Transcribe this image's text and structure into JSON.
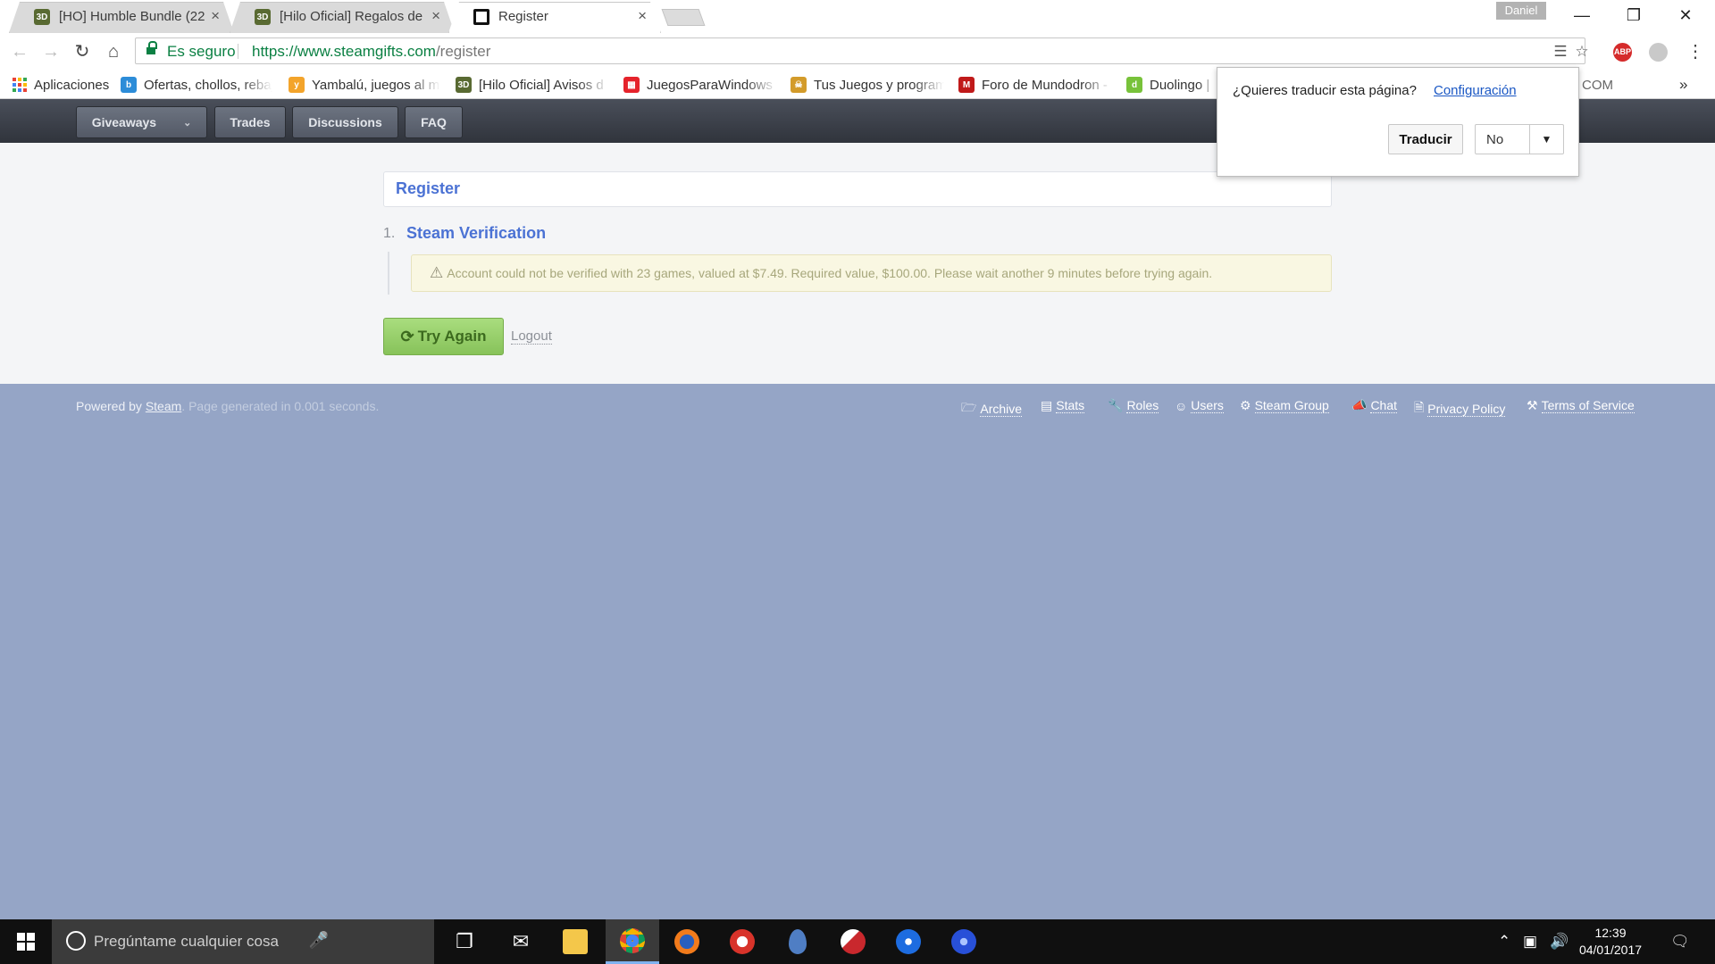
{
  "browser": {
    "tabs": [
      {
        "title": "[HO] Humble Bundle (22",
        "icon": "3djuegos-icon"
      },
      {
        "title": "[Hilo Oficial] Regalos de",
        "icon": "3djuegos-icon"
      },
      {
        "title": "Register",
        "icon": "steamgifts-icon"
      }
    ],
    "profile_name": "Daniel",
    "secure_label": "Es seguro",
    "url_host": "https://www.steamgifts.com",
    "url_path": "/register",
    "bookmarks": [
      {
        "label": "Aplicaciones",
        "icon": "apps-grid-icon"
      },
      {
        "label": "Ofertas, chollos, rebaj",
        "icon": "bargains-icon"
      },
      {
        "label": "Yambalú, juegos al m",
        "icon": "yambalu-icon"
      },
      {
        "label": "[Hilo Oficial] Avisos d",
        "icon": "3djuegos-icon"
      },
      {
        "label": "JuegosParaWindows -",
        "icon": "windows-games-icon"
      },
      {
        "label": "Tus Juegos y program",
        "icon": "pirate-icon"
      },
      {
        "label": "Foro de Mundodron -",
        "icon": "mundodron-icon"
      },
      {
        "label": "Duolingo |",
        "icon": "duolingo-icon"
      },
      {
        "label": "COM",
        "icon": ""
      }
    ],
    "bookmarks_overflow": "»",
    "colors": {
      "secure_green": "#0b8043",
      "link_blue": "#1a57c4"
    }
  },
  "translate_popup": {
    "question": "¿Quieres traducir esta página?",
    "settings_link": "Configuración",
    "translate_button": "Traducir",
    "no_option": "No"
  },
  "site": {
    "nav": [
      {
        "label": "Giveaways",
        "has_caret": true
      },
      {
        "label": "Trades"
      },
      {
        "label": "Discussions"
      },
      {
        "label": "FAQ"
      }
    ],
    "page_heading": "Register",
    "step": {
      "number": "1.",
      "title": "Steam Verification",
      "message": "Account could not be verified with 23 games, valued at $7.49. Required value, $100.00. Please wait another 9 minutes before trying again."
    },
    "try_again_label": "Try Again",
    "logout_label": "Logout",
    "colors": {
      "accent": "#4b72d4",
      "button_green": "#87c25a",
      "footer_bg": "#95a5c6",
      "nav_bg": "#30343c"
    }
  },
  "footer": {
    "powered_prefix": "Powered by ",
    "powered_link": "Steam",
    "generated": ". Page generated in 0.001 seconds.",
    "links": [
      {
        "label": "Archive",
        "icon": "folder-open-icon"
      },
      {
        "label": "Stats",
        "icon": "bar-chart-icon"
      },
      {
        "label": "Roles",
        "icon": "wrench-icon"
      },
      {
        "label": "Users",
        "icon": "user-icon"
      },
      {
        "label": "Steam Group",
        "icon": "steam-icon"
      },
      {
        "label": "Chat",
        "icon": "bullhorn-icon"
      },
      {
        "label": "Privacy Policy",
        "icon": "file-icon"
      },
      {
        "label": "Terms of Service",
        "icon": "gavel-icon"
      }
    ]
  },
  "taskbar": {
    "search_placeholder": "Pregúntame cualquier cosa",
    "time": "12:39",
    "date": "04/01/2017"
  }
}
